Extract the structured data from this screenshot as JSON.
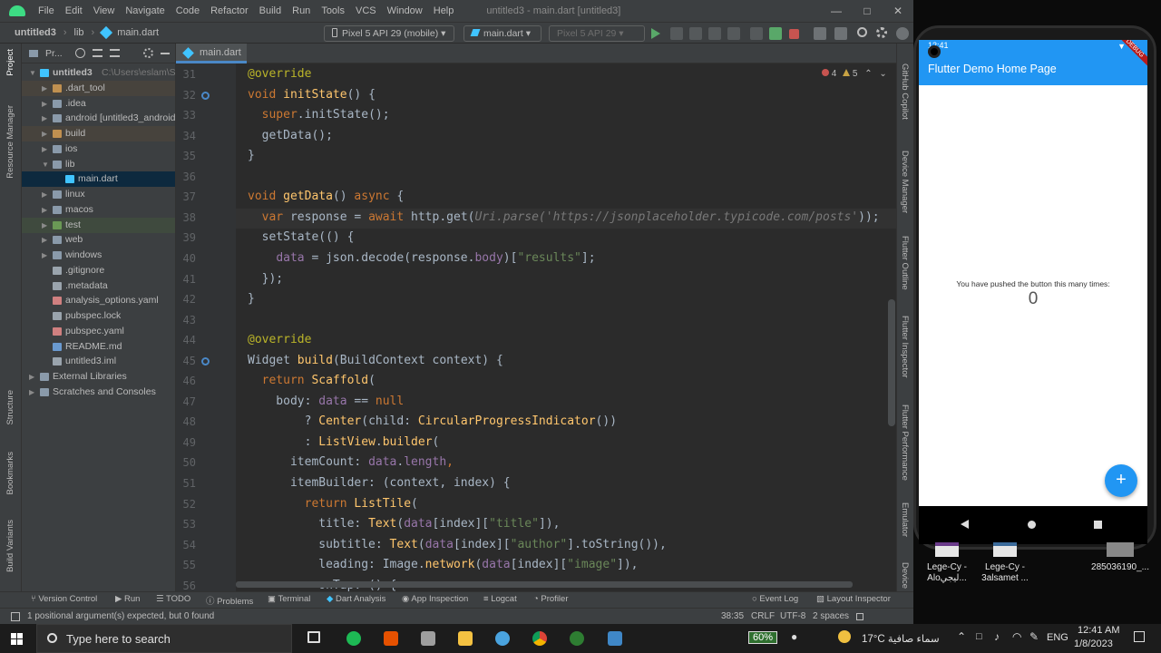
{
  "ide": {
    "menu": [
      "File",
      "Edit",
      "View",
      "Navigate",
      "Code",
      "Refactor",
      "Build",
      "Run",
      "Tools",
      "VCS",
      "Window",
      "Help"
    ],
    "window_title": "untitled3 - main.dart [untitled3]",
    "breadcrumbs": [
      "untitled3",
      "lib",
      "main.dart"
    ],
    "device_combo": "Pixel 5 API 29 (mobile)",
    "run_config": "main.dart",
    "device_combo_2": "Pixel 5 API 29",
    "tab": "main.dart",
    "project_header": "Pr...",
    "tree": [
      {
        "label": "untitled3",
        "extra": "C:\\Users\\eslam\\Stud",
        "indent": 0,
        "open": true,
        "kind": "root"
      },
      {
        "label": ".dart_tool",
        "indent": 1,
        "kind": "folder-orange"
      },
      {
        "label": ".idea",
        "indent": 1,
        "kind": "folder"
      },
      {
        "label": "android [untitled3_android]",
        "indent": 1,
        "kind": "folder"
      },
      {
        "label": "build",
        "indent": 1,
        "kind": "folder-orange"
      },
      {
        "label": "ios",
        "indent": 1,
        "kind": "folder"
      },
      {
        "label": "lib",
        "indent": 1,
        "open": true,
        "kind": "folder"
      },
      {
        "label": "main.dart",
        "indent": 2,
        "kind": "dart",
        "selected": true
      },
      {
        "label": "linux",
        "indent": 1,
        "kind": "folder"
      },
      {
        "label": "macos",
        "indent": 1,
        "kind": "folder"
      },
      {
        "label": "test",
        "indent": 1,
        "kind": "folder-green"
      },
      {
        "label": "web",
        "indent": 1,
        "kind": "folder"
      },
      {
        "label": "windows",
        "indent": 1,
        "kind": "folder"
      },
      {
        "label": ".gitignore",
        "indent": 1,
        "kind": "file"
      },
      {
        "label": ".metadata",
        "indent": 1,
        "kind": "file"
      },
      {
        "label": "analysis_options.yaml",
        "indent": 1,
        "kind": "yaml"
      },
      {
        "label": "pubspec.lock",
        "indent": 1,
        "kind": "file"
      },
      {
        "label": "pubspec.yaml",
        "indent": 1,
        "kind": "yaml"
      },
      {
        "label": "README.md",
        "indent": 1,
        "kind": "md"
      },
      {
        "label": "untitled3.iml",
        "indent": 1,
        "kind": "file"
      },
      {
        "label": "External Libraries",
        "indent": 0,
        "kind": "lib"
      },
      {
        "label": "Scratches and Consoles",
        "indent": 0,
        "kind": "scratch"
      }
    ],
    "inspection": {
      "errors": "4",
      "warnings": "5"
    },
    "code_lines": [
      {
        "n": "31",
        "html": "<span class=\"an\">@override</span>"
      },
      {
        "n": "32",
        "html": "<span class=\"kw\">void</span> <span class=\"fn\">initState</span>() {"
      },
      {
        "n": "33",
        "html": "  <span class=\"kw\">super</span>.initState();"
      },
      {
        "n": "34",
        "html": "  getData();"
      },
      {
        "n": "35",
        "html": "}"
      },
      {
        "n": "36",
        "html": ""
      },
      {
        "n": "37",
        "html": "<span class=\"kw\">void</span> <span class=\"fn\">getData</span>() <span class=\"kw\">async</span> {"
      },
      {
        "n": "38",
        "html": "  <span class=\"kw\">var</span> response = <span class=\"kw\">await</span> http.get(<span class=\"cm\">Uri.parse('https://jsonplaceholder.typicode.com/posts'</span>));"
      },
      {
        "n": "39",
        "html": "  setState(() {"
      },
      {
        "n": "40",
        "html": "    <span class=\"pr\">data</span> = json.decode(response.<span class=\"pr\">body</span>)[<span class=\"st\">\"results\"</span>];"
      },
      {
        "n": "41",
        "html": "  });"
      },
      {
        "n": "42",
        "html": "}"
      },
      {
        "n": "43",
        "html": ""
      },
      {
        "n": "44",
        "html": "<span class=\"an\">@override</span>"
      },
      {
        "n": "45",
        "html": "Widget <span class=\"fn\">build</span>(BuildContext context) {"
      },
      {
        "n": "46",
        "html": "  <span class=\"kw\">return</span> <span class=\"fn\">Scaffold</span>("
      },
      {
        "n": "47",
        "html": "    body: <span class=\"pr\">data</span> == <span class=\"kw\">null</span>"
      },
      {
        "n": "48",
        "html": "        ? <span class=\"fn\">Center</span>(child: <span class=\"fn\">CircularProgressIndicator</span>())"
      },
      {
        "n": "49",
        "html": "        : <span class=\"fn\">ListView</span>.<span class=\"fn\">builder</span>("
      },
      {
        "n": "50",
        "html": "      itemCount: <span class=\"pr\">data</span>.<span class=\"pr\">length</span><span class=\"kw\">,</span>"
      },
      {
        "n": "51",
        "html": "      itemBuilder: (context, index) {"
      },
      {
        "n": "52",
        "html": "        <span class=\"kw\">return</span> <span class=\"fn\">ListTile</span>("
      },
      {
        "n": "53",
        "html": "          title: <span class=\"fn\">Text</span>(<span class=\"pr\">data</span>[index][<span class=\"st\">\"title\"</span>]),"
      },
      {
        "n": "54",
        "html": "          subtitle: <span class=\"fn\">Text</span>(<span class=\"pr\">data</span>[index][<span class=\"st\">\"author\"</span>].toString()),"
      },
      {
        "n": "55",
        "html": "          leading: Image.<span class=\"fn\">network</span>(<span class=\"pr\">data</span>[index][<span class=\"st\">\"image\"</span>]),"
      },
      {
        "n": "56",
        "html": "          onTap: () {"
      }
    ],
    "right_tools": [
      "GitHub Copilot",
      "Device Manager",
      "Flutter Outline",
      "Flutter Inspector",
      "Flutter Performance",
      "Emulator",
      "Device"
    ],
    "left_tools": [
      "Project",
      "Resource Manager",
      "Structure",
      "Bookmarks",
      "Build Variants"
    ],
    "bottom_tools": [
      "Version Control",
      "Run",
      "TODO",
      "Problems",
      "Terminal",
      "Dart Analysis",
      "App Inspection",
      "Logcat",
      "Profiler",
      "Event Log",
      "Layout Inspector"
    ],
    "status_message": "1 positional argument(s) expected, but 0 found",
    "status_right": [
      "38:35",
      "CRLF",
      "UTF-8",
      "2 spaces"
    ]
  },
  "phone": {
    "status_time": "12:41",
    "debug_badge": "DEBUG",
    "app_title": "Flutter Demo Home Page",
    "counter_label": "You have pushed the button this many times:",
    "counter_value": "0",
    "fab": "+"
  },
  "desktop": [
    {
      "label": "Lege-Cy - Aloليجي..."
    },
    {
      "label": "Lege-Cy - 3alsamet ..."
    },
    {
      "label": "285036190_..."
    }
  ],
  "taskbar": {
    "search_placeholder": "Type here to search",
    "battery": "60%",
    "weather": "17°C سماء صافية",
    "lang": "ENG",
    "time": "12:41 AM",
    "date": "1/8/2023"
  }
}
